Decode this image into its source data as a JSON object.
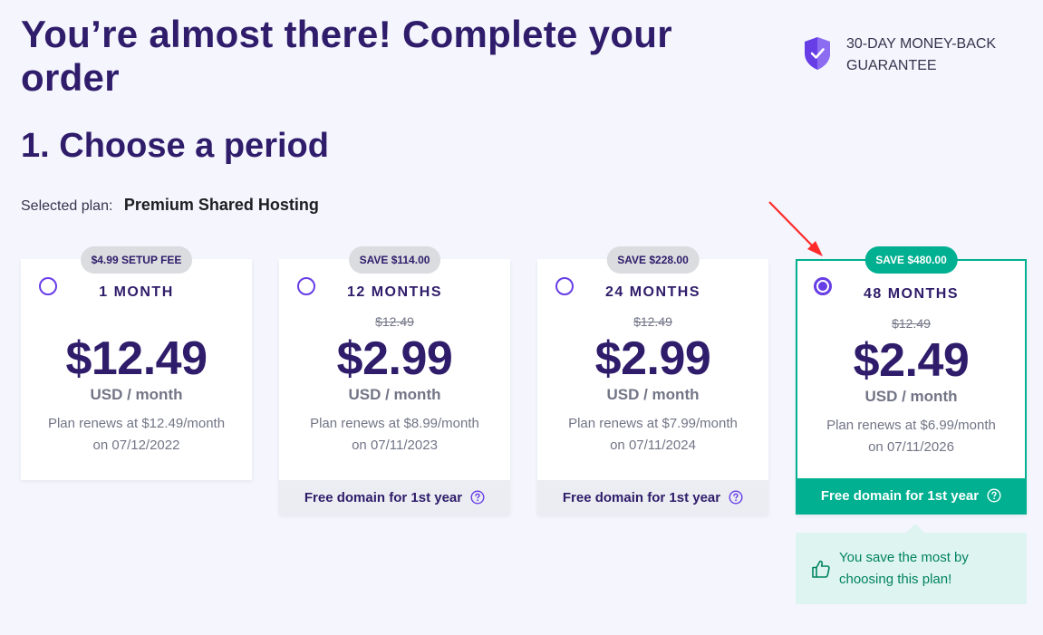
{
  "header": {
    "title": "You’re almost there! Complete your order",
    "guarantee": "30-DAY MONEY-BACK GUARANTEE"
  },
  "section": {
    "title": "1. Choose a period",
    "selected_plan_label": "Selected plan:",
    "selected_plan_value": "Premium Shared Hosting"
  },
  "plans": [
    {
      "badge": "$4.99 SETUP FEE",
      "period": "1 MONTH",
      "old_price": "",
      "price": "$12.49",
      "unit": "USD / month",
      "renew_line1": "Plan renews at $12.49/month",
      "renew_line2": "on 07/12/2022",
      "footer": "",
      "selected": false
    },
    {
      "badge": "SAVE $114.00",
      "period": "12 MONTHS",
      "old_price": "$12.49",
      "price": "$2.99",
      "unit": "USD / month",
      "renew_line1": "Plan renews at $8.99/month",
      "renew_line2": "on 07/11/2023",
      "footer": "Free domain for 1st year",
      "selected": false
    },
    {
      "badge": "SAVE $228.00",
      "period": "24 MONTHS",
      "old_price": "$12.49",
      "price": "$2.99",
      "unit": "USD / month",
      "renew_line1": "Plan renews at $7.99/month",
      "renew_line2": "on 07/11/2024",
      "footer": "Free domain for 1st year",
      "selected": false
    },
    {
      "badge": "SAVE $480.00",
      "period": "48 MONTHS",
      "old_price": "$12.49",
      "price": "$2.49",
      "unit": "USD / month",
      "renew_line1": "Plan renews at $6.99/month",
      "renew_line2": "on 07/11/2026",
      "footer": "Free domain for 1st year",
      "selected": true
    }
  ],
  "savings_note": "You save the most by choosing this plan!",
  "colors": {
    "brand": "#673de6",
    "heading": "#2f1c6a",
    "success": "#00b090",
    "annotation_arrow": "#ff2a2a"
  },
  "icons": [
    "shield-check-icon",
    "help-circle-icon",
    "thumbs-up-icon",
    "annotation-arrow-icon"
  ]
}
